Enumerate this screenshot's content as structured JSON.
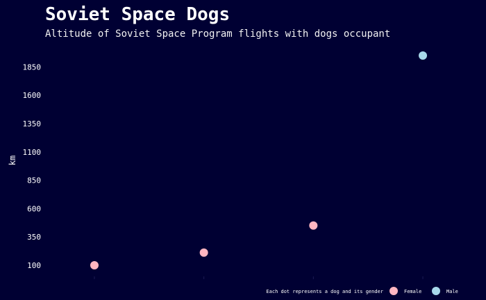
{
  "title": "Soviet Space Dogs",
  "subtitle": "Altitude of Soviet Space Program flights with dogs occupant",
  "chart_data": {
    "type": "scatter",
    "ylabel": "km",
    "xlabel": "",
    "ylim": [
      -10,
      2060
    ],
    "yticks": [
      100,
      350,
      600,
      850,
      1100,
      1350,
      1600,
      1850
    ],
    "y_tick_labels": [
      "100",
      "350",
      "600",
      "850",
      "1100",
      "1350",
      "1600",
      "1850"
    ],
    "x": [
      1,
      2,
      3,
      4
    ],
    "xlim": [
      0.55,
      4.45
    ],
    "points": [
      {
        "x": 1,
        "y": 100,
        "gender": "Female"
      },
      {
        "x": 2,
        "y": 212,
        "gender": "Female"
      },
      {
        "x": 3,
        "y": 451,
        "gender": "Female"
      },
      {
        "x": 4,
        "y": 1950,
        "gender": "Male"
      }
    ],
    "grid": false,
    "legend": {
      "caption": "Each dot represents a dog and its gender",
      "placement": "bottom-right",
      "entries": [
        {
          "label": "Female",
          "color": "#ffb6c1"
        },
        {
          "label": "Male",
          "color": "#a8d8ea"
        }
      ]
    }
  },
  "colors": {
    "background": "#000033",
    "female": "#ffb6c1",
    "male": "#a8d8ea",
    "text": "#ffffff"
  }
}
